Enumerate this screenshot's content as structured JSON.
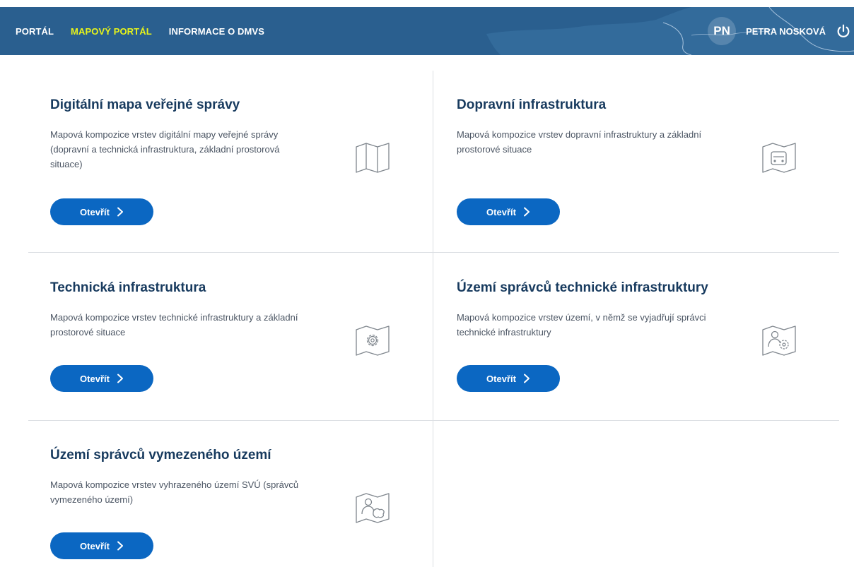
{
  "nav": {
    "portal": "PORTÁL",
    "mapovy_portal": "MAPOVÝ PORTÁL",
    "informace": "INFORMACE O DMVS"
  },
  "user": {
    "initials": "PN",
    "name": "PETRA NOSKOVÁ"
  },
  "tiles": [
    {
      "title": "Digitální mapa veřejné správy",
      "description": "Mapová kompozice vrstev digitální mapy veřejné správy (dopravní a technická infrastruktura, základní prostorová situace)",
      "button": "Otevřít",
      "icon": "map-icon"
    },
    {
      "title": "Dopravní infrastruktura",
      "description": "Mapová kompozice vrstev dopravní infrastruktury a základní prostorové situace",
      "button": "Otevřít",
      "icon": "map-vehicle-icon"
    },
    {
      "title": "Technická infrastruktura",
      "description": "Mapová kompozice vrstev technické infrastruktury a základní prostorové situace",
      "button": "Otevřít",
      "icon": "map-gear-icon"
    },
    {
      "title": "Území správců technické infrastruktury",
      "description": "Mapová kompozice vrstev území, v němž se vyjadřují správci technické infrastruktury",
      "button": "Otevřít",
      "icon": "map-user-gear-icon"
    },
    {
      "title": "Území správců vymezeného území",
      "description": "Mapová kompozice vrstev vyhrazeného území SVÚ (správců vymezeného území)",
      "button": "Otevřít",
      "icon": "map-user-area-icon"
    }
  ],
  "colors": {
    "header_bg": "#2a5f8f",
    "button_bg": "#0b67c2",
    "title_text": "#173a5e",
    "highlight_text": "#e8f41a",
    "highlight_bg": "#2f7a3a"
  }
}
